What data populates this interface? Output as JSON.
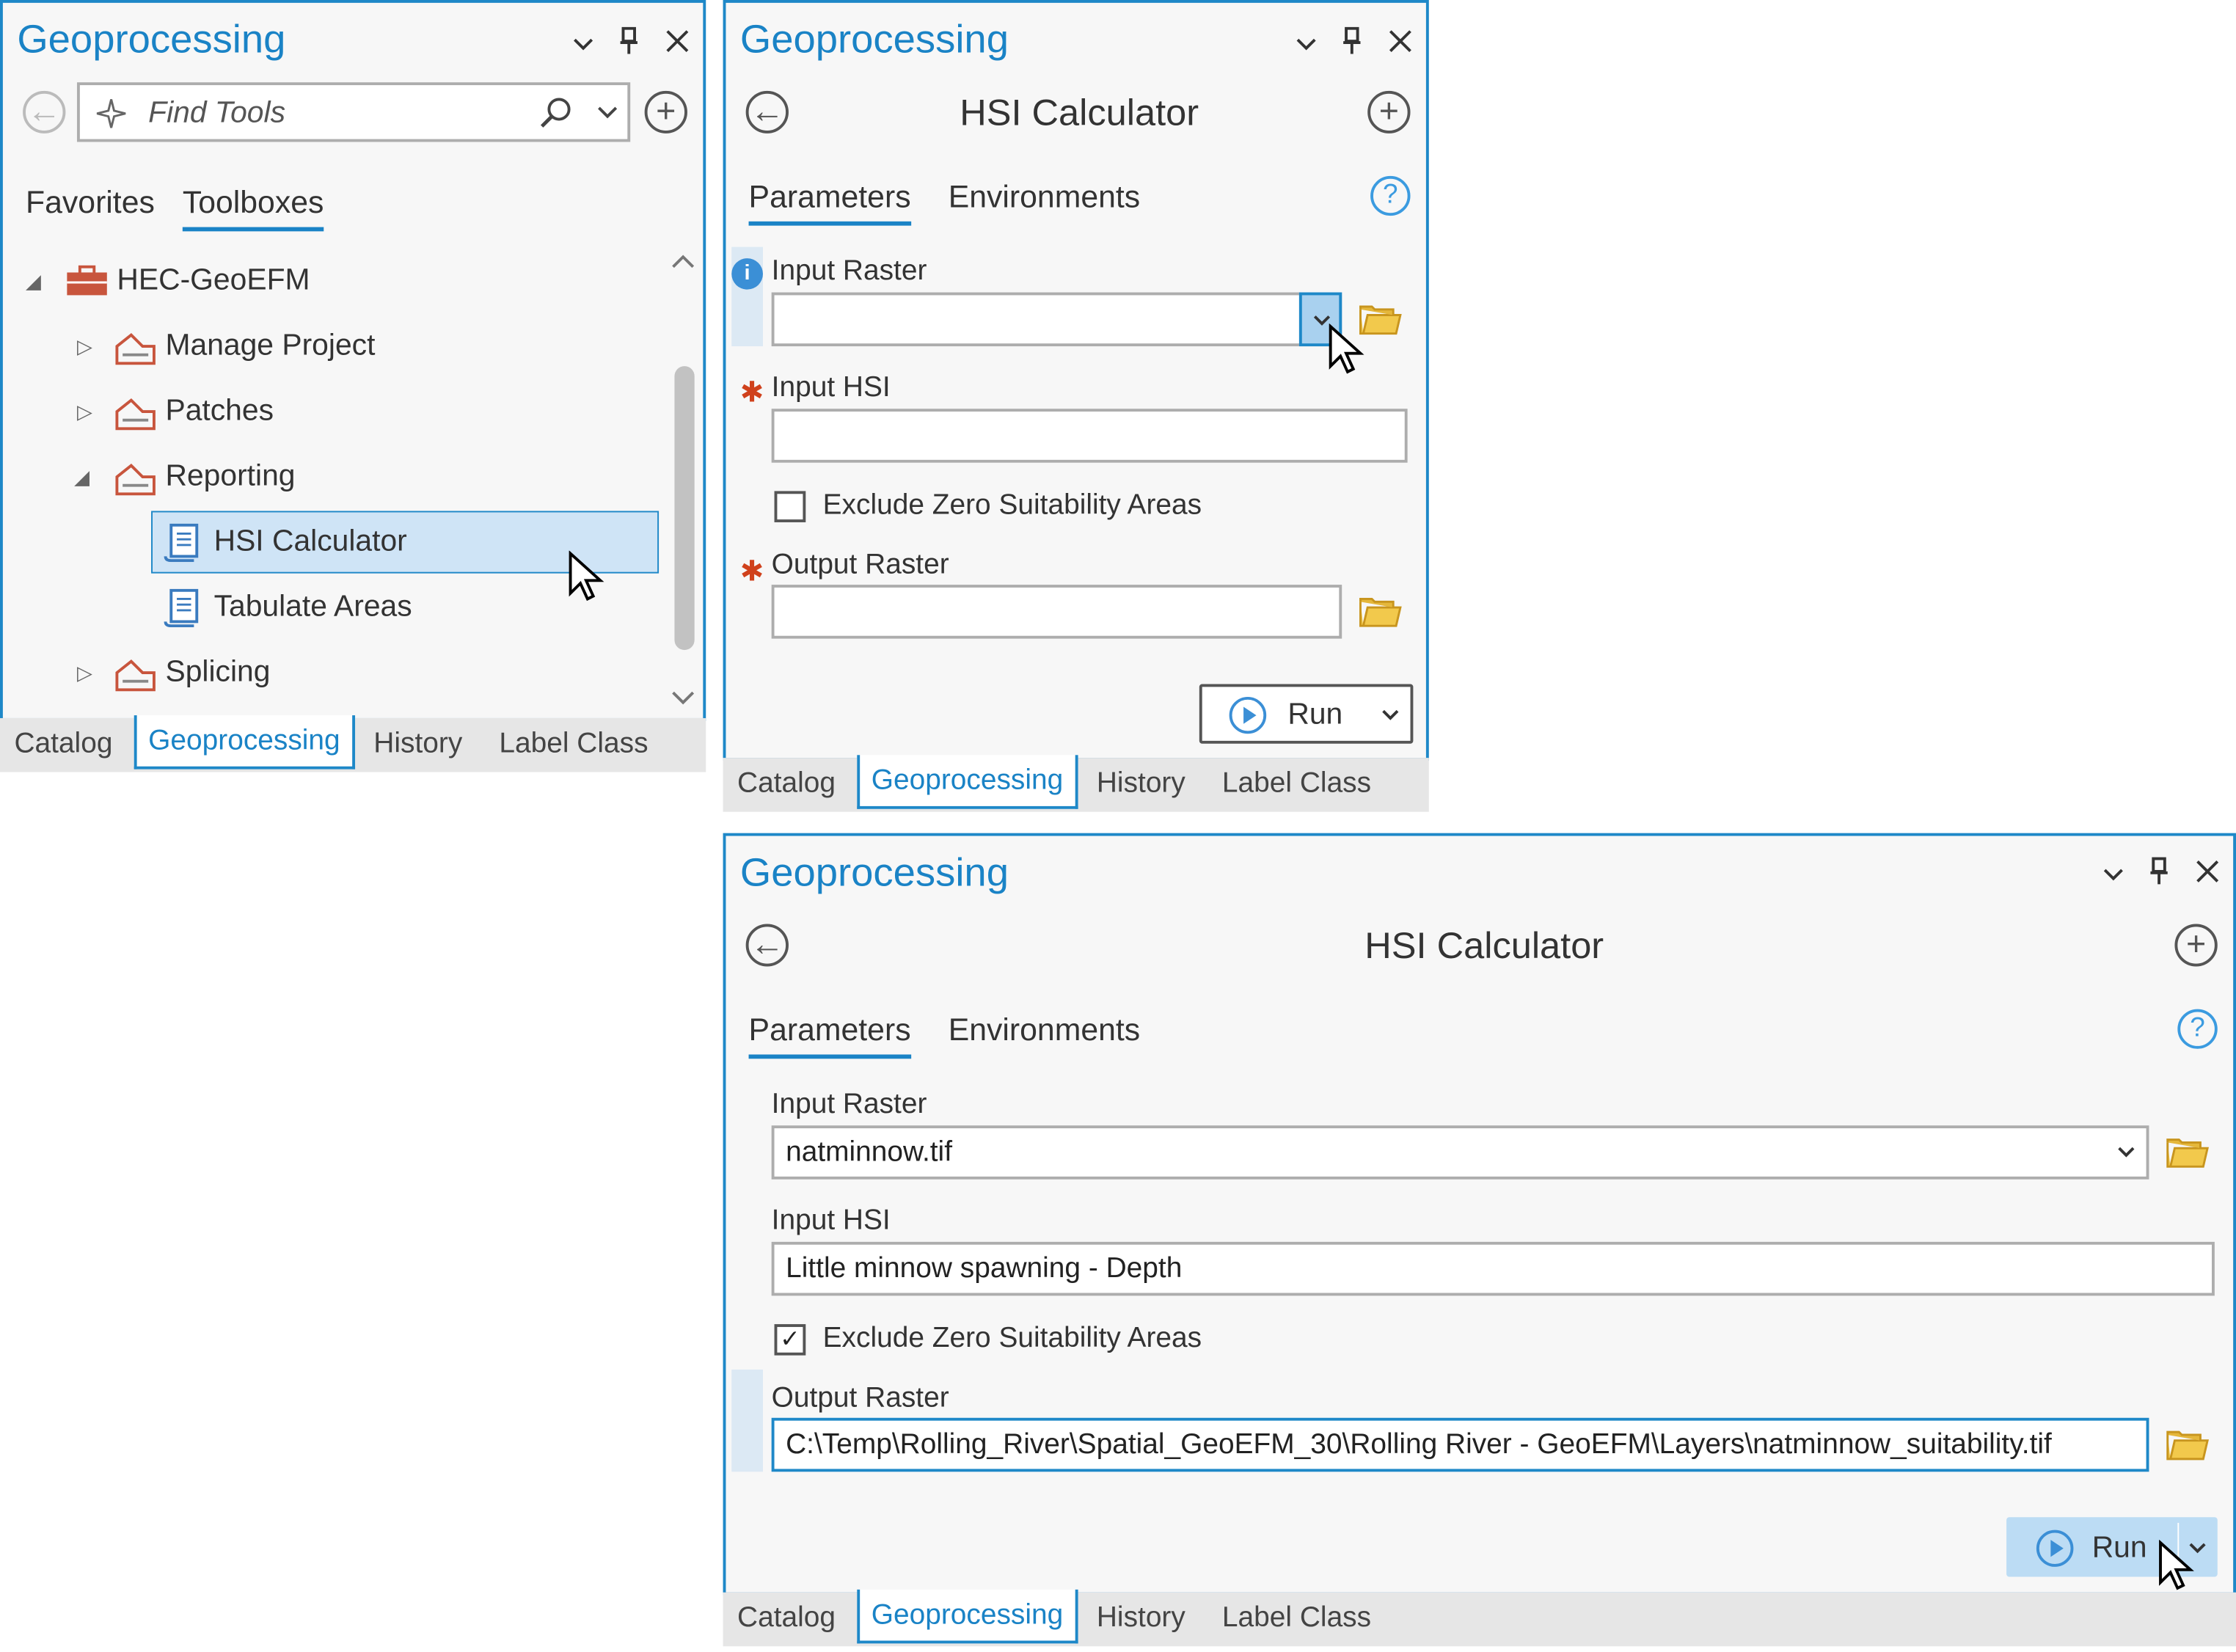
{
  "pane_title": "Geoprocessing",
  "panel1": {
    "search_placeholder": "Find Tools",
    "tabs": [
      "Favorites",
      "Toolboxes"
    ],
    "tree": {
      "root": "HEC-GeoEFM",
      "toolsets": [
        "Manage Project",
        "Patches",
        "Reporting",
        "Splicing"
      ],
      "reporting_tools": [
        "HSI Calculator",
        "Tabulate Areas"
      ]
    }
  },
  "tool": {
    "title": "HSI Calculator",
    "tabs": [
      "Parameters",
      "Environments"
    ],
    "params": {
      "input_raster": "Input Raster",
      "input_hsi": "Input HSI",
      "exclude_zero": "Exclude Zero Suitability Areas",
      "output_raster": "Output Raster"
    },
    "run_label": "Run"
  },
  "panel3_values": {
    "input_raster": "natminnow.tif",
    "input_hsi": "Little minnow spawning - Depth",
    "output_raster": "C:\\Temp\\Rolling_River\\Spatial_GeoEFM_30\\Rolling River - GeoEFM\\Layers\\natminnow_suitability.tif",
    "exclude_zero_checked": true
  },
  "bottom_tabs": [
    "Catalog",
    "Geoprocessing",
    "History",
    "Label Class"
  ],
  "colors": {
    "accent": "#1a83c6",
    "required": "#d0411c",
    "selection": "#cfe4f6"
  }
}
